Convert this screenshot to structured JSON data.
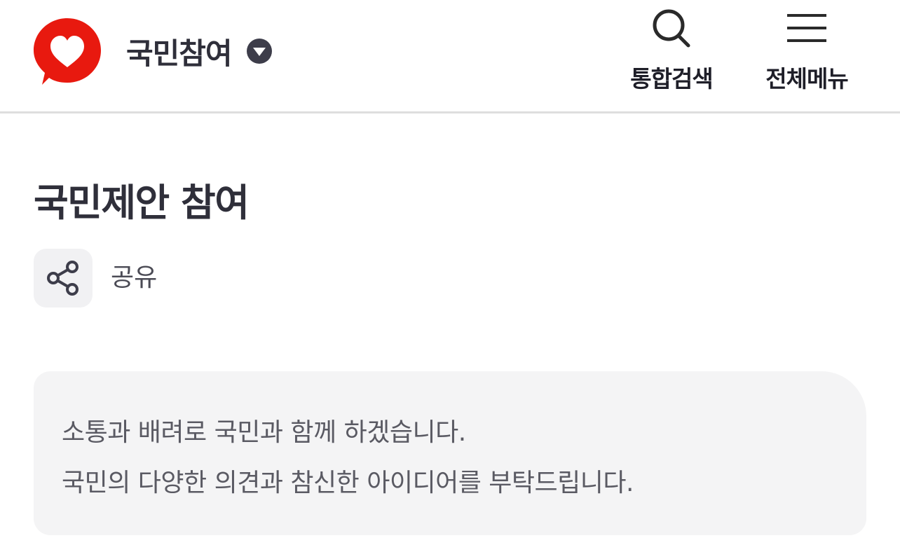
{
  "header": {
    "site_title": "국민참여",
    "search_label": "통합검색",
    "menu_label": "전체메뉴",
    "logo_icon": "heart-speech-bubble-icon",
    "brand_color": "#e8190f"
  },
  "page": {
    "title": "국민제안 참여",
    "share_label": "공유",
    "notice_lines": [
      "소통과 배려로 국민과 함께 하겠습니다.",
      "국민의 다양한 의견과 참신한 아이디어를 부탁드립니다."
    ]
  }
}
